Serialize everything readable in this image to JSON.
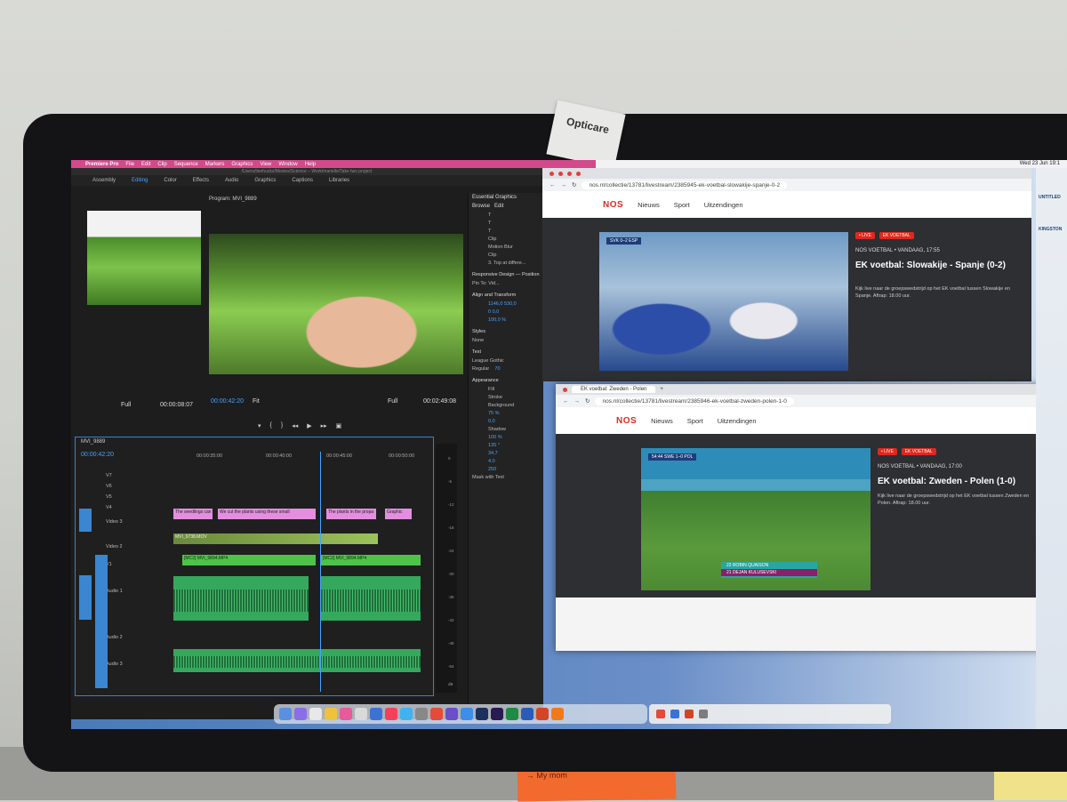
{
  "menubar": {
    "app": "Premiere Pro",
    "items": [
      "File",
      "Edit",
      "Clip",
      "Sequence",
      "Markers",
      "Graphics",
      "View",
      "Window",
      "Help"
    ],
    "clock": "Wed 23 Jun  19:1"
  },
  "premiere": {
    "path": "/Users/lienhuckx/Movies/Science – Work/marielle/Take two project",
    "workspaces": [
      "Assembly",
      "Editing",
      "Color",
      "Effects",
      "Audio",
      "Graphics",
      "Captions",
      "Libraries"
    ],
    "active_workspace": "Editing",
    "program_title": "Program: MVI_9889",
    "source_zoom": "Full",
    "source_timecode": "00:00:08:07",
    "program_timecode": "00:00:42:20",
    "program_fit": "Fit",
    "program_zoom": "Full",
    "program_duration": "00:02:49:08",
    "timeline": {
      "sequence": "MVI_9889",
      "timecode": "00:00:42:20",
      "ruler": [
        "00:00:35:00",
        "00:00:40:00",
        "00:00:45:00",
        "00:00:50:00"
      ],
      "tracks": [
        {
          "id": "V7",
          "label": ""
        },
        {
          "id": "V6",
          "label": ""
        },
        {
          "id": "V5",
          "label": ""
        },
        {
          "id": "V4",
          "label": ""
        },
        {
          "id": "V3",
          "label": "Video 3"
        },
        {
          "id": "V2",
          "label": "Video 2"
        },
        {
          "id": "V1",
          "label": ""
        },
        {
          "id": "A1",
          "label": "Audio 1"
        },
        {
          "id": "A2",
          "label": "Audio 2"
        },
        {
          "id": "A3",
          "label": "Audio 3"
        },
        {
          "id": "A4",
          "label": ""
        }
      ],
      "clips": {
        "c1": "The seedlings can",
        "c2": "We cut the plants using these small",
        "c3": "The plants in the propa",
        "c4": "Graphic",
        "c5": "MVI_9738.MOV",
        "c6": "[MC2] MVI_9894.MP4",
        "c7": "[MC2] MVI_9894.MP4"
      }
    },
    "meter_ticks": [
      "0",
      "-6",
      "-12",
      "-18",
      "-24",
      "-30",
      "-36",
      "-42",
      "-48",
      "-54",
      "dB"
    ],
    "essential_graphics": {
      "title": "Essential Graphics",
      "tabs": [
        "Browse",
        "Edit"
      ],
      "layers": [
        "T",
        "T",
        "T",
        "Clip",
        "Motion Blur",
        "Clip",
        "3. Top at differe..."
      ],
      "responsive": "Responsive Design — Position",
      "pin_to": "Pin To:",
      "pin_value": "Vid...",
      "align_title": "Align and Transform",
      "position": "1146,0",
      "position2": "530,0",
      "rotation": "0",
      "anchor": "0,0",
      "scale": "100,0 %",
      "styles_title": "Styles",
      "style_value": "None",
      "text_title": "Text",
      "font": "League Gothic",
      "font_style": "Regular",
      "font_size": "70",
      "appearance_title": "Appearance",
      "fill": "Fill",
      "stroke": "Stroke",
      "background": "Background",
      "bg_opacity": "75 %",
      "bg_size": "0,0",
      "shadow": "Shadow",
      "shadow_opacity": "100 %",
      "shadow_angle": "135 °",
      "shadow_distance": "34,7",
      "shadow_size": "4,0",
      "shadow_blur": "250",
      "mask": "Mask with Text"
    }
  },
  "browser1": {
    "url": "nos.nl/collectie/13781/livestream/2385945-ek-voetbal-slowakije-spanje-0-2",
    "nav": [
      "Nieuws",
      "Sport",
      "Uitzendingen"
    ],
    "logo": "NOS",
    "badge_live": "• LIVE",
    "badge_ek": "EK VOETBAL",
    "meta": "NOS VOETBAL  •  VANDAAG, 17:55",
    "title": "EK voetbal: Slowakije - Spanje (0-2)",
    "desc": "Kijk live naar de groepswedstrijd op het EK voetbal tussen Slowakije en Spanje. Aftrap: 18.00 uur.",
    "score": "SVK 0–2 ESP"
  },
  "browser2": {
    "tab": "EK voetbal: Zweden - Polen",
    "url": "nos.nl/collectie/13781/livestream/2385946-ek-voetbal-zweden-polen-1-0",
    "nav": [
      "Nieuws",
      "Sport",
      "Uitzendingen"
    ],
    "logo": "NOS",
    "badge_live": "• LIVE",
    "badge_ek": "EK VOETBAL",
    "meta": "NOS VOETBAL  •  VANDAAG, 17:00",
    "title": "EK voetbal: Zweden - Polen (1-0)",
    "desc": "Kijk live naar de groepswedstrijd op het EK voetbal tussen Zweden en Polen. Aftrap: 18.00 uur.",
    "score": "54:44  SWE 1–0 POL",
    "lower1": "22 ROBIN QUAISON",
    "lower2": "21 DEJAN KULUSEVSKI"
  },
  "right_strip": [
    "UNTITLED",
    "KINGSTON"
  ],
  "sticky_note": "→ My mom",
  "tag": "Opticare"
}
